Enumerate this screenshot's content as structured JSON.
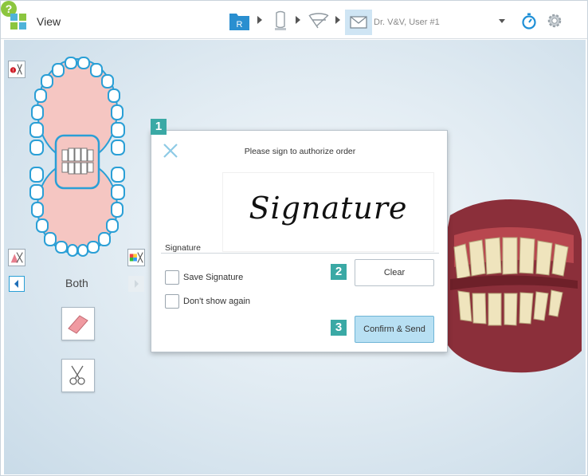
{
  "header": {
    "view_label": "View",
    "rx_letter": "R",
    "doctor_user": "Dr. V&V, User #1"
  },
  "sidebar": {
    "jaw_label": "Both"
  },
  "dialog": {
    "title": "Please sign to authorize order",
    "signature_text": "Signature",
    "signature_label": "Signature",
    "save_signature_label": "Save Signature",
    "dont_show_label": "Don't show again",
    "clear_label": "Clear",
    "confirm_label": "Confirm & Send"
  },
  "callouts": {
    "one": "1",
    "two": "2",
    "three": "3"
  },
  "colors": {
    "accent_teal": "#3aa9a5",
    "confirm_blue": "#b8e0f3",
    "help_green": "#8cc63f",
    "tooth_pink": "#f5c6c2"
  }
}
